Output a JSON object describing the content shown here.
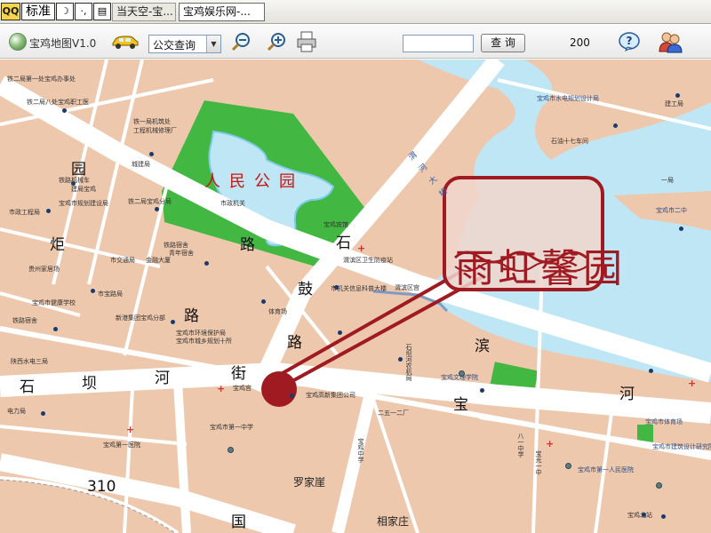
{
  "taskbar": {
    "ime_logo": "QQ",
    "ime_mode": "标准",
    "ime_moon": "☽",
    "ime_punct": "·,",
    "ime_kbd": "▤",
    "tabs": [
      {
        "label": "当天空-宝..."
      },
      {
        "label": "宝鸡娱乐网-..."
      }
    ]
  },
  "toolbar": {
    "title": "宝鸡地图V1.0",
    "mode_value": "公交查询",
    "search_value": "",
    "search_button": "查 询",
    "zoom_level": "200"
  },
  "icons": {
    "app_logo": "globe-icon",
    "car": "car-icon",
    "zoom_out": "magnifier-minus-icon",
    "zoom_in": "magnifier-plus-icon",
    "print": "printer-icon",
    "help": "help-icon",
    "users": "users-icon"
  },
  "colors": {
    "block": "#edc8ad",
    "road": "#ffffff",
    "water": "#bfe6f5",
    "park": "#42b842",
    "stamp": "#a01a22"
  },
  "map": {
    "stamp_text": "雨虹馨园",
    "park_name": "人民公园",
    "roads": {
      "yuan": "园",
      "lu_1": "路",
      "ju": "炬",
      "lu_2": "路",
      "shi_1": "石",
      "gu": "鼓",
      "lu_3": "路",
      "shi_2": "石",
      "ba": "坝",
      "he": "河",
      "jie": "街",
      "bao": "宝",
      "bin": "滨",
      "he_2": "河",
      "r310": "310",
      "guo": "国"
    },
    "areas": {
      "luojiaya": "罗家崖",
      "xiangjiazhuang": "相家庄"
    },
    "river_label": "渭 河 大 桥",
    "labels": {
      "l1": "铁二局第一处宝鸡办事处",
      "l2": "铁二局八处宝鸡职工医",
      "l3": "铁一局机筑处",
      "l4": "工程机械修理厂",
      "l5": "城建局",
      "l6": "宝鸡市水电规划设计局",
      "l7": "建工局",
      "l8": "铁路机械车",
      "l9": "建局宝鸡",
      "l10": "宝鸡市规划建设局",
      "l11": "石油十七车间",
      "l12": "一局",
      "l13": "宝鸡市二中",
      "l14": "市政工程局",
      "l15": "铁二局宝鸡分局",
      "l16": "铁路宿舍",
      "l17": "宝鸡宾馆",
      "l18": "市政机关",
      "l19": "宝鸡宾馆",
      "l20": "青年宿舍",
      "l21": "贵州家居场",
      "l22": "市交通局",
      "l23": "金融大厦",
      "l24": "渭滨区卫生防疫站",
      "l25": "市机关信息科普大楼",
      "l26": "渭滨区宫",
      "l27": "宝鸡市健康学校",
      "l28": "体育场",
      "l29": "市宝路局",
      "l30": "新港集团宝鸡分部",
      "l31": "宝鸡市环境保护局",
      "l32": "宝鸡市城乡规划十所",
      "l33": "铁路宿舍",
      "l34": "陕西水电三局",
      "l35": "宝鸡宫",
      "l36": "石坝河农机局",
      "l37": "宝鸡文理学院",
      "l38": "电力局",
      "l39": "铁路宿舍",
      "l40": "宝鸡市第二人民医院",
      "l41": "宝鸡高新集团公司",
      "l42": "二五一二厂",
      "l43": "宝鸡市包装总厂",
      "l44": "宝鸡市委",
      "l45": "宝鸡市人民检察院",
      "l46": "宝鸡市第一中学",
      "l47": "宝鸡市妇幼保健院",
      "l48": "宝鸡市人民法院",
      "l49": "宝鸡中学",
      "l50": "宝鸡市中医院",
      "l51": "宝鸡第一医院",
      "l52": "渭滨文化广场",
      "l53": "宝鸡市公园管理局",
      "l54": "宝鸡市建筑设计研究院",
      "l55": "八一中学",
      "l56": "宝鸡第一职业中学",
      "l57": "宝光一中",
      "l58": "宝鸡银河科技大厦",
      "l59": "宝鸡市东风路小学",
      "l60": "宝鸡市第三中学",
      "l61": "宝鸡市第一人民医院",
      "l62": "宝鸡市体育场",
      "l63": "宝鸡北站"
    }
  }
}
